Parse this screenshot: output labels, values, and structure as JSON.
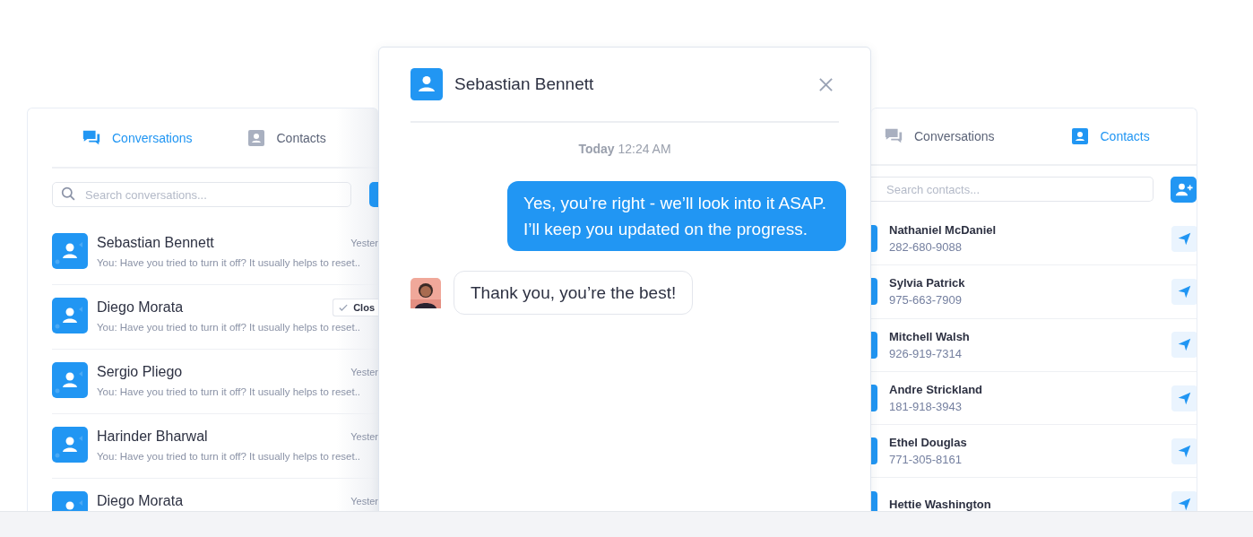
{
  "conversations_panel": {
    "tabs": [
      {
        "label": "Conversations",
        "selected": true
      },
      {
        "label": "Contacts",
        "selected": false
      }
    ],
    "search": {
      "placeholder": "Search conversations..."
    },
    "conversations": [
      {
        "name": "Sebastian Bennett",
        "kind": "dated",
        "meta": "Yester",
        "preview": "You: Have you tried to turn it off? It usually helps to reset.."
      },
      {
        "name": "Diego Morata",
        "kind": "closed",
        "meta": "Clos",
        "preview": "You: Have you tried to turn it off? It usually helps to reset.."
      },
      {
        "name": "Sergio Pliego",
        "kind": "dated",
        "meta": "Yester",
        "preview": "You: Have you tried to turn it off? It usually helps to reset.."
      },
      {
        "name": "Harinder Bharwal",
        "kind": "dated",
        "meta": "Yester",
        "preview": "You: Have you tried to turn it off? It usually helps to reset.."
      },
      {
        "name": "Diego Morata",
        "kind": "dated",
        "meta": "Yester"
      }
    ]
  },
  "chat": {
    "title": "Sebastian Bennett",
    "date": "**Today** 12:24 AM",
    "messages": [
      {
        "kind": "outgoing",
        "text": "Yes, you’re right - we’ll look into it ASAP.\nI’ll keep you updated on the progress."
      },
      {
        "kind": "incoming",
        "text": "Thank you, you’re the best!"
      }
    ]
  },
  "contacts_panel": {
    "tabs": [
      {
        "label": "Conversations",
        "selected": false
      },
      {
        "label": "Contacts",
        "selected": true
      }
    ],
    "search": {
      "placeholder": "Search contacts..."
    },
    "contacts": [
      {
        "name": "Nathaniel McDaniel",
        "phone": "282-680-9088"
      },
      {
        "name": "Sylvia Patrick",
        "phone": "975-663-7909"
      },
      {
        "name": "Mitchell Walsh",
        "phone": "926-919-7314"
      },
      {
        "name": "Andre Strickland",
        "phone": "181-918-3943"
      },
      {
        "name": "Ethel Douglas",
        "phone": "771-305-8161"
      },
      {
        "name": "Hettie Washington"
      }
    ]
  }
}
